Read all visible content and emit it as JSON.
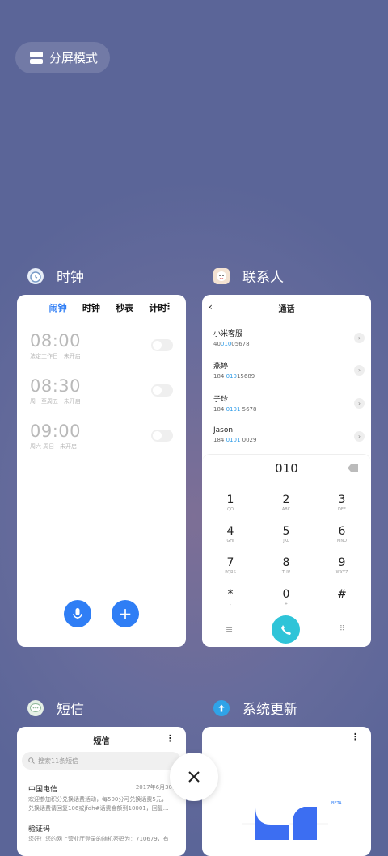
{
  "split_mode": {
    "label": "分屏模式"
  },
  "apps": {
    "clock": {
      "title": "时钟",
      "tabs": [
        "闹钟",
        "时钟",
        "秒表",
        "计时"
      ],
      "alarms": [
        {
          "time": "08:00",
          "desc": "法定工作日 | 未开启"
        },
        {
          "time": "08:30",
          "desc": "周一至周五 | 未开启"
        },
        {
          "time": "09:00",
          "desc": "周六 周日 | 未开启"
        }
      ]
    },
    "contacts": {
      "title": "联系人",
      "header": "通话",
      "list": [
        {
          "name": "小米客服",
          "pre": "40",
          "hit": "010",
          "post": "05678"
        },
        {
          "name": "燕婷",
          "pre": "184 ",
          "hit": "010",
          "post": "15689"
        },
        {
          "name": "子玲",
          "pre": "184 ",
          "hit": "0101",
          "post": " 5678"
        },
        {
          "name": "Jason",
          "pre": "184 ",
          "hit": "0101",
          "post": " 0029"
        }
      ],
      "dial_input": "010",
      "keys": [
        {
          "d": "1",
          "l": "QO"
        },
        {
          "d": "2",
          "l": "ABC"
        },
        {
          "d": "3",
          "l": "DEF"
        },
        {
          "d": "4",
          "l": "GHI"
        },
        {
          "d": "5",
          "l": "JKL"
        },
        {
          "d": "6",
          "l": "MNO"
        },
        {
          "d": "7",
          "l": "PQRS"
        },
        {
          "d": "8",
          "l": "TUV"
        },
        {
          "d": "9",
          "l": "WXYZ"
        },
        {
          "d": "*",
          "l": ","
        },
        {
          "d": "0",
          "l": "+"
        },
        {
          "d": "#",
          "l": ""
        }
      ]
    },
    "sms": {
      "title": "短信",
      "header": "短信",
      "search_placeholder": "搜索11条短信",
      "threads": [
        {
          "sender": "中国电信",
          "date": "2017年6月30日",
          "line1": "欢迎参加积分兑换话费活动，每500分可兑换话费5元，",
          "line2": "兑换话费请回复106或jfdh#话费金额到10001，回复..."
        },
        {
          "sender": "验证码",
          "date": "",
          "line1": "您好！您的网上营业厅登录的随机密码为：710679，有",
          "line2": ""
        }
      ]
    },
    "update": {
      "title": "系统更新",
      "beta": "BETA"
    }
  },
  "colors": {
    "accent": "#2f7ef5",
    "dial_green": "#2fc4d8",
    "bg": "#5b6598"
  }
}
